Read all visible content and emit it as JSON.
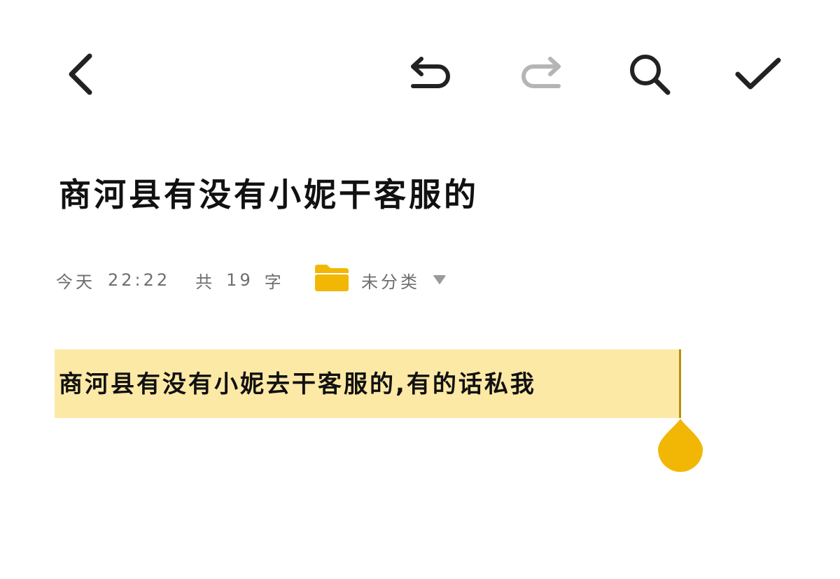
{
  "toolbar": {
    "back_icon": "chevron-left-icon",
    "undo_icon": "undo-icon",
    "redo_icon": "redo-icon",
    "search_icon": "search-icon",
    "confirm_icon": "check-icon"
  },
  "note": {
    "title": "商河县有没有小妮干客服的",
    "date": "今天",
    "time": "22:22",
    "count_prefix": "共",
    "count": "19",
    "count_suffix": "字",
    "category": "未分类",
    "body": "商河县有没有小妮去干客服的,有的话私我"
  },
  "colors": {
    "accent": "#f2b705",
    "selection": "#fde9a6",
    "text": "#111111",
    "meta_text": "#6e6e6e",
    "disabled_icon": "#b5b5b5"
  }
}
